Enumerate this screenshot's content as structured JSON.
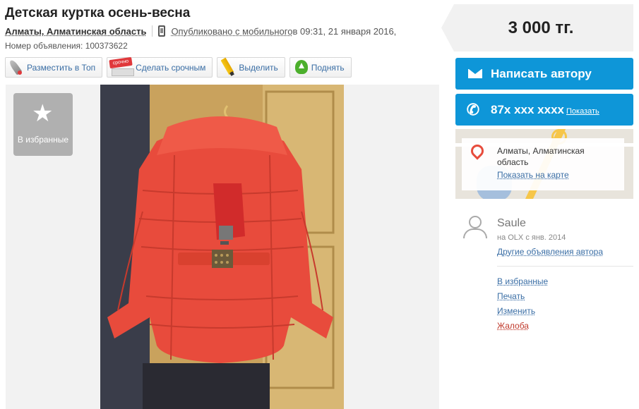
{
  "listing": {
    "title": "Детская куртка осень-весна",
    "location": "Алматы, Алматинская область",
    "published_prefix": "Опубликовано с мобильного",
    "published_time": " в 09:31, 21 января 2016,",
    "ad_number": "Номер объявления: 100373622"
  },
  "actions": [
    {
      "label": "Разместить в Топ",
      "icon": "rocket-icon"
    },
    {
      "label": "Сделать срочным",
      "icon": "urgent-badge-icon"
    },
    {
      "label": "Выделить",
      "icon": "pencil-icon"
    },
    {
      "label": "Поднять",
      "icon": "arrow-up-icon"
    }
  ],
  "gallery": {
    "favorite_label": "В избранные"
  },
  "price": "3 000 тг.",
  "contact": {
    "write_label": "Написать автору",
    "phone": "87x xxx xxxx",
    "show_label": "Показать"
  },
  "map": {
    "address": "Алматы, Алматинская область",
    "show_on_map": "Показать на карте"
  },
  "user": {
    "name": "Saule",
    "since": "на OLX с янв. 2014",
    "other_ads": "Другие объявления автора"
  },
  "side_links": {
    "favorites": "В избранные",
    "print": "Печать",
    "edit": "Изменить",
    "report": "Жалоба"
  },
  "colors": {
    "accent_blue": "#0e96d8",
    "link_blue": "#3a6ea5",
    "report_red": "#c0392b"
  }
}
